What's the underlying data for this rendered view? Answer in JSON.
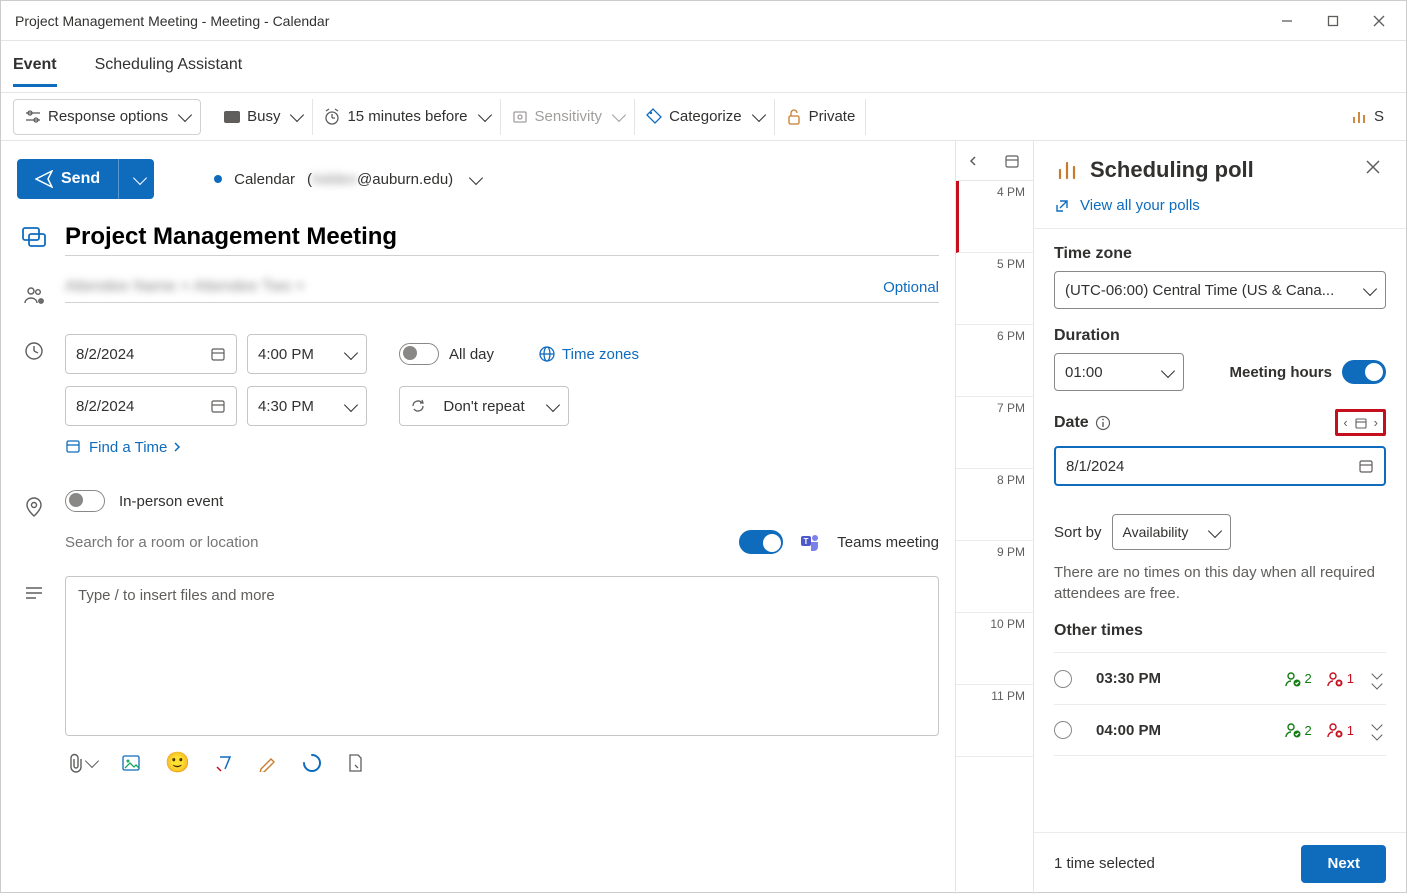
{
  "window": {
    "title": "Project Management Meeting - Meeting - Calendar"
  },
  "tabs": {
    "event": "Event",
    "scheduling": "Scheduling Assistant"
  },
  "ribbon": {
    "response": "Response options",
    "busy": "Busy",
    "reminder": "15 minutes before",
    "sensitivity": "Sensitivity",
    "categorize": "Categorize",
    "private": "Private",
    "poll": "S"
  },
  "send": {
    "label": "Send"
  },
  "calendar": {
    "label": "Calendar",
    "suffix": "@auburn.edu)"
  },
  "event": {
    "title": "Project Management Meeting",
    "optional": "Optional",
    "start_date": "8/2/2024",
    "start_time": "4:00 PM",
    "end_date": "8/2/2024",
    "end_time": "4:30 PM",
    "allday": "All day",
    "timezones": "Time zones",
    "repeat": "Don't repeat",
    "findtime": "Find a Time",
    "inperson": "In-person event",
    "room_placeholder": "Search for a room or location",
    "teams": "Teams meeting",
    "body_placeholder": "Type / to insert files and more"
  },
  "hours": [
    "4 PM",
    "5 PM",
    "6 PM",
    "7 PM",
    "8 PM",
    "9 PM",
    "10 PM",
    "11 PM"
  ],
  "panel": {
    "title": "Scheduling poll",
    "viewall": "View all your polls",
    "tz_label": "Time zone",
    "tz_value": "(UTC-06:00) Central Time (US & Cana...",
    "duration_label": "Duration",
    "duration_value": "01:00",
    "hours_label": "Meeting hours",
    "date_label": "Date",
    "date_value": "8/1/2024",
    "sortby": "Sort by",
    "sort_value": "Availability",
    "hint": "There are no times on this day when all required attendees are free.",
    "other": "Other times",
    "options": [
      {
        "time": "03:30 PM",
        "avail": 2,
        "unavail": 1
      },
      {
        "time": "04:00 PM",
        "avail": 2,
        "unavail": 1
      }
    ],
    "selected": "1 time selected",
    "next": "Next"
  }
}
